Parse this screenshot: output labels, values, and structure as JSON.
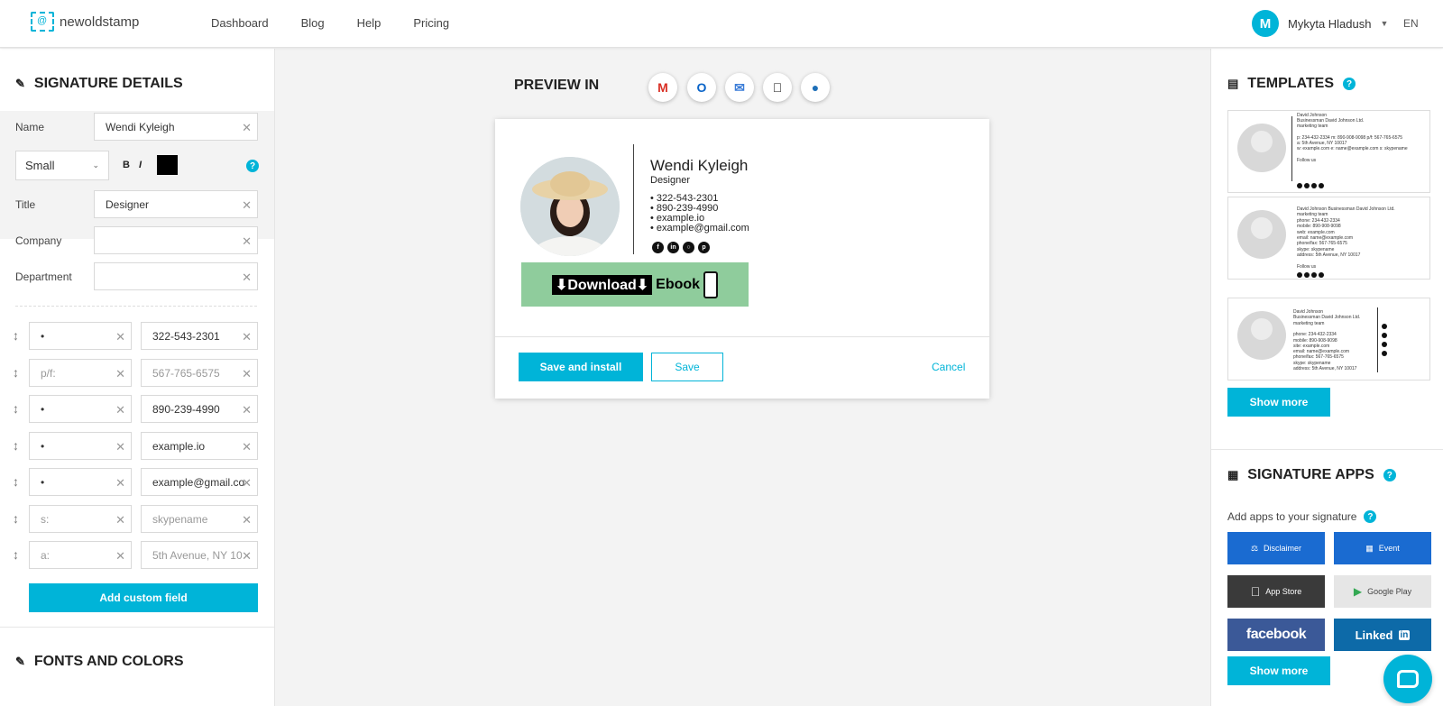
{
  "header": {
    "logo": "newoldstamp",
    "nav": [
      "Dashboard",
      "Blog",
      "Help",
      "Pricing"
    ],
    "user": {
      "initial": "M",
      "name": "Mykyta Hladush"
    },
    "lang": "EN"
  },
  "left": {
    "title": "SIGNATURE DETAILS",
    "name_label": "Name",
    "name_value": "Wendi Kyleigh",
    "size": "Small",
    "bold": "B",
    "italic": "I",
    "help": "?",
    "title_label": "Title",
    "title_value": "Designer",
    "company_label": "Company",
    "department_label": "Department",
    "fields": [
      {
        "prefix": "•",
        "value": "322-543-2301",
        "placeholder_prefix": false,
        "placeholder_value": false
      },
      {
        "prefix": "p/f:",
        "value": "567-765-6575",
        "placeholder_prefix": true,
        "placeholder_value": true
      },
      {
        "prefix": "•",
        "value": "890-239-4990",
        "placeholder_prefix": false,
        "placeholder_value": false
      },
      {
        "prefix": "•",
        "value": "example.io",
        "placeholder_prefix": false,
        "placeholder_value": false
      },
      {
        "prefix": "•",
        "value": "example@gmail.co",
        "placeholder_prefix": false,
        "placeholder_value": false
      },
      {
        "prefix": "s:",
        "value": "skypename",
        "placeholder_prefix": true,
        "placeholder_value": true
      },
      {
        "prefix": "a:",
        "value": "5th Avenue, NY 10",
        "placeholder_prefix": true,
        "placeholder_value": true
      }
    ],
    "add_custom": "Add custom field",
    "fonts_title": "FONTS AND COLORS"
  },
  "center": {
    "preview_title": "PREVIEW IN",
    "clients": [
      "gmail-icon",
      "outlook-icon",
      "mac-mail-icon",
      "apple-mail-icon",
      "thunderbird-icon"
    ],
    "signature": {
      "name": "Wendi Kyleigh",
      "title": "Designer",
      "lines": [
        "• 322-543-2301",
        "• 890-239-4990",
        "• example.io",
        "• example@gmail.com"
      ],
      "socials": [
        "facebook-icon",
        "linkedin-icon",
        "instagram-icon",
        "pinterest-icon"
      ],
      "banner_download": "⬇Download⬇",
      "banner_ebook": "Ebook"
    },
    "save_install": "Save and install",
    "save": "Save",
    "cancel": "Cancel"
  },
  "right": {
    "templates_title": "TEMPLATES",
    "template_name": "David Johnson",
    "templates": [
      {
        "lines": [
          "David Johnson",
          "Businessman David Johnson Ltd.",
          "marketing team",
          "",
          "p: 234-432-2334  m: 890-908-9098  p/f: 567-765-6575",
          "a: 5th Avenue, NY 10017",
          "w: example.com  e: name@example.com  s: skypename",
          "",
          "Follow us"
        ]
      },
      {
        "lines": [
          "David Johnson  Businessman David Johnson Ltd.",
          "marketing team",
          "phone: 234-432-2334",
          "mobile: 890-908-9098",
          "web: example.com",
          "email: name@example.com",
          "phone/fax: 567-765-6575",
          "skype: skypename",
          "address: 5th Avenue, NY 10017",
          "",
          "Follow us"
        ]
      },
      {
        "lines": [
          "David Johnson",
          "Businessman David Johnson Ltd.",
          "marketing team",
          "",
          "phone: 234-432-2334",
          "mobile: 890-908-9098",
          "site: example.com",
          "email: name@example.com",
          "phone/fax: 567-765-6575",
          "skype: skypename",
          "address: 5th Avenue, NY 10017"
        ]
      }
    ],
    "show_more": "Show more",
    "apps_title": "SIGNATURE APPS",
    "apps_sub": "Add apps to your signature",
    "apps": {
      "disclaimer": "Disclaimer",
      "event": "Event",
      "appstore": "App Store",
      "googleplay": "Google Play",
      "facebook": "facebook",
      "linkedin": "Linked"
    },
    "show_more2": "Show more"
  },
  "colors": {
    "accent": "#00b4d8",
    "app_blue": "#1a6bd1",
    "facebook": "#3b5998",
    "linkedin": "#0d6aa8"
  }
}
